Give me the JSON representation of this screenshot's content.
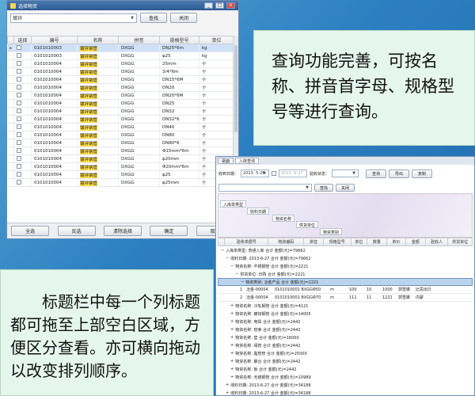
{
  "select_window": {
    "title": "选择物资",
    "search_input_value": "镀锌",
    "buttons": {
      "search": "查找",
      "close": "关闭"
    },
    "columns": [
      "选择",
      "编号",
      "名称",
      "拼音",
      "规格型号",
      "单位"
    ],
    "rows": [
      {
        "code": "0101010003",
        "name": "镀锌钢管",
        "pinyin": "DXGG",
        "spec": "DN25*6m",
        "unit": "kg"
      },
      {
        "code": "0101010003",
        "name": "镀锌钢管",
        "pinyin": "DXGG",
        "spec": "φ25",
        "unit": "kg"
      },
      {
        "code": "0101010004",
        "name": "镀锌钢管",
        "pinyin": "DXGG",
        "spec": "25mm",
        "unit": "个"
      },
      {
        "code": "0101010004",
        "name": "镀锌钢管",
        "pinyin": "DXGG",
        "spec": "3/4*6m",
        "unit": "个"
      },
      {
        "code": "0101010004",
        "name": "镀锌钢管",
        "pinyin": "DXGG",
        "spec": "DN15*6M",
        "unit": "个"
      },
      {
        "code": "0101010004",
        "name": "镀锌钢管",
        "pinyin": "DXGG",
        "spec": "DN20",
        "unit": "个"
      },
      {
        "code": "0101010004",
        "name": "镀锌钢管",
        "pinyin": "DXGG",
        "spec": "DN20*6M",
        "unit": "个"
      },
      {
        "code": "0101010004",
        "name": "镀锌钢管",
        "pinyin": "DXGG",
        "spec": "DN25",
        "unit": "个"
      },
      {
        "code": "0101010004",
        "name": "镀锌钢管",
        "pinyin": "DXGG",
        "spec": "DN32",
        "unit": "个"
      },
      {
        "code": "0101010004",
        "name": "镀锌钢管",
        "pinyin": "DXGG",
        "spec": "DN32*6",
        "unit": "个"
      },
      {
        "code": "0101010004",
        "name": "镀锌钢管",
        "pinyin": "DXGG",
        "spec": "DN40",
        "unit": "个"
      },
      {
        "code": "0101010004",
        "name": "镀锌钢管",
        "pinyin": "DXGG",
        "spec": "DN80",
        "unit": "个"
      },
      {
        "code": "0101010004",
        "name": "镀锌钢管",
        "pinyin": "DXGG",
        "spec": "DN80*6",
        "unit": "个"
      },
      {
        "code": "0101010004",
        "name": "镀锌钢管",
        "pinyin": "DXGG",
        "spec": "Φ15mm*6m",
        "unit": "个"
      },
      {
        "code": "0101010004",
        "name": "镀锌钢管",
        "pinyin": "DXGG",
        "spec": "φ20mm",
        "unit": "个"
      },
      {
        "code": "0101010004",
        "name": "镀锌钢管",
        "pinyin": "DXGG",
        "spec": "Φ20mm*6m",
        "unit": "个"
      },
      {
        "code": "0101010004",
        "name": "镀锌钢管",
        "pinyin": "DXGG",
        "spec": "φ25",
        "unit": "个"
      },
      {
        "code": "0101010004",
        "name": "镀锌钢管",
        "pinyin": "DXGG",
        "spec": "φ25mm",
        "unit": "个"
      }
    ],
    "footer_buttons": [
      "全选",
      "反选",
      "清除选择",
      "确定",
      "取消"
    ]
  },
  "callout_top": {
    "text": "查询功能完善，可按名称、拼音首字母、规格型号等进行查询。"
  },
  "callout_bottom": {
    "text": "标题栏中每一个列标题都可拖至上部空白区域，方便区分查看。亦可横向拖动以改变排列顺序。"
  },
  "inbound_window": {
    "tabs": [
      "桌面",
      "入库查询"
    ],
    "filters": {
      "date_label": "收到日期：",
      "date_from": "2013- 5-26",
      "date_to": "2013- 6-27",
      "status_label": "验收状态："
    },
    "buttons": {
      "query": "查询",
      "export": "导出",
      "copy": "复制",
      "search": "查找",
      "close": "关闭"
    },
    "group_chips": [
      "入库单类型",
      "收料日期",
      "物资名称",
      "供货单位",
      "物资类别"
    ],
    "columns": [
      "验收单据号",
      "物资编码",
      "拼音",
      "规格型号",
      "单位",
      "数量",
      "单价",
      "金额",
      "验收人",
      "供货单位"
    ],
    "tree_rows": [
      "入库单类型: 普通入库 合计 金额(元)=79662",
      "收料日期: 2013-6-27 合计 金额(元)=79662",
      "物资名称: 不锈钢管 合计 金额(元)=2221",
      "供货单位: 日购 合计 金额(元)=2221",
      "物资类别: 冶金产品 合计 金额(元)=2221"
    ],
    "detail_rows": [
      {
        "idx": "1",
        "code": "冶金-00004",
        "spec": "0101010001 BXGG",
        "size": "Φ50",
        "unit": "m",
        "qty": "100",
        "price": "10",
        "amount": "1000",
        "receiver": "郭雪娜",
        "supplier": "比思出行"
      },
      {
        "idx": "2",
        "code": "冶金-00004",
        "spec": "0101010001 BXGG",
        "size": "Φ70",
        "unit": "m",
        "qty": "111",
        "price": "11",
        "amount": "1221",
        "receiver": "郭雪娜",
        "supplier": "内蒙"
      }
    ],
    "summary_rows": [
      "物资名称: 冷轧钢管 合计 金额(元)=4121",
      "物资名称: 镀锌钢管 合计 金额(元)=14005",
      "物资名称: 电焊 合计 金额(元)=2442",
      "物资名称: 管束 合计 金额(元)=2442",
      "物资名称: 垫 合计 金额(元)=16000",
      "物资名称: 阀管 合计 金额(元)=2442",
      "物资名称: 脂管管 合计 金额(元)=25000",
      "物资名称: 聚合 合计 金额(元)=2442",
      "物资名称: 板 合计 金额(元)=2442",
      "物资名称: 无缝钢管 合计 金额(元)=10989",
      "收料日期: 2013-6-27 合计 金额(元)=34188",
      "收料日期: 2013-6-27 合计 金额(元)=34188"
    ]
  }
}
